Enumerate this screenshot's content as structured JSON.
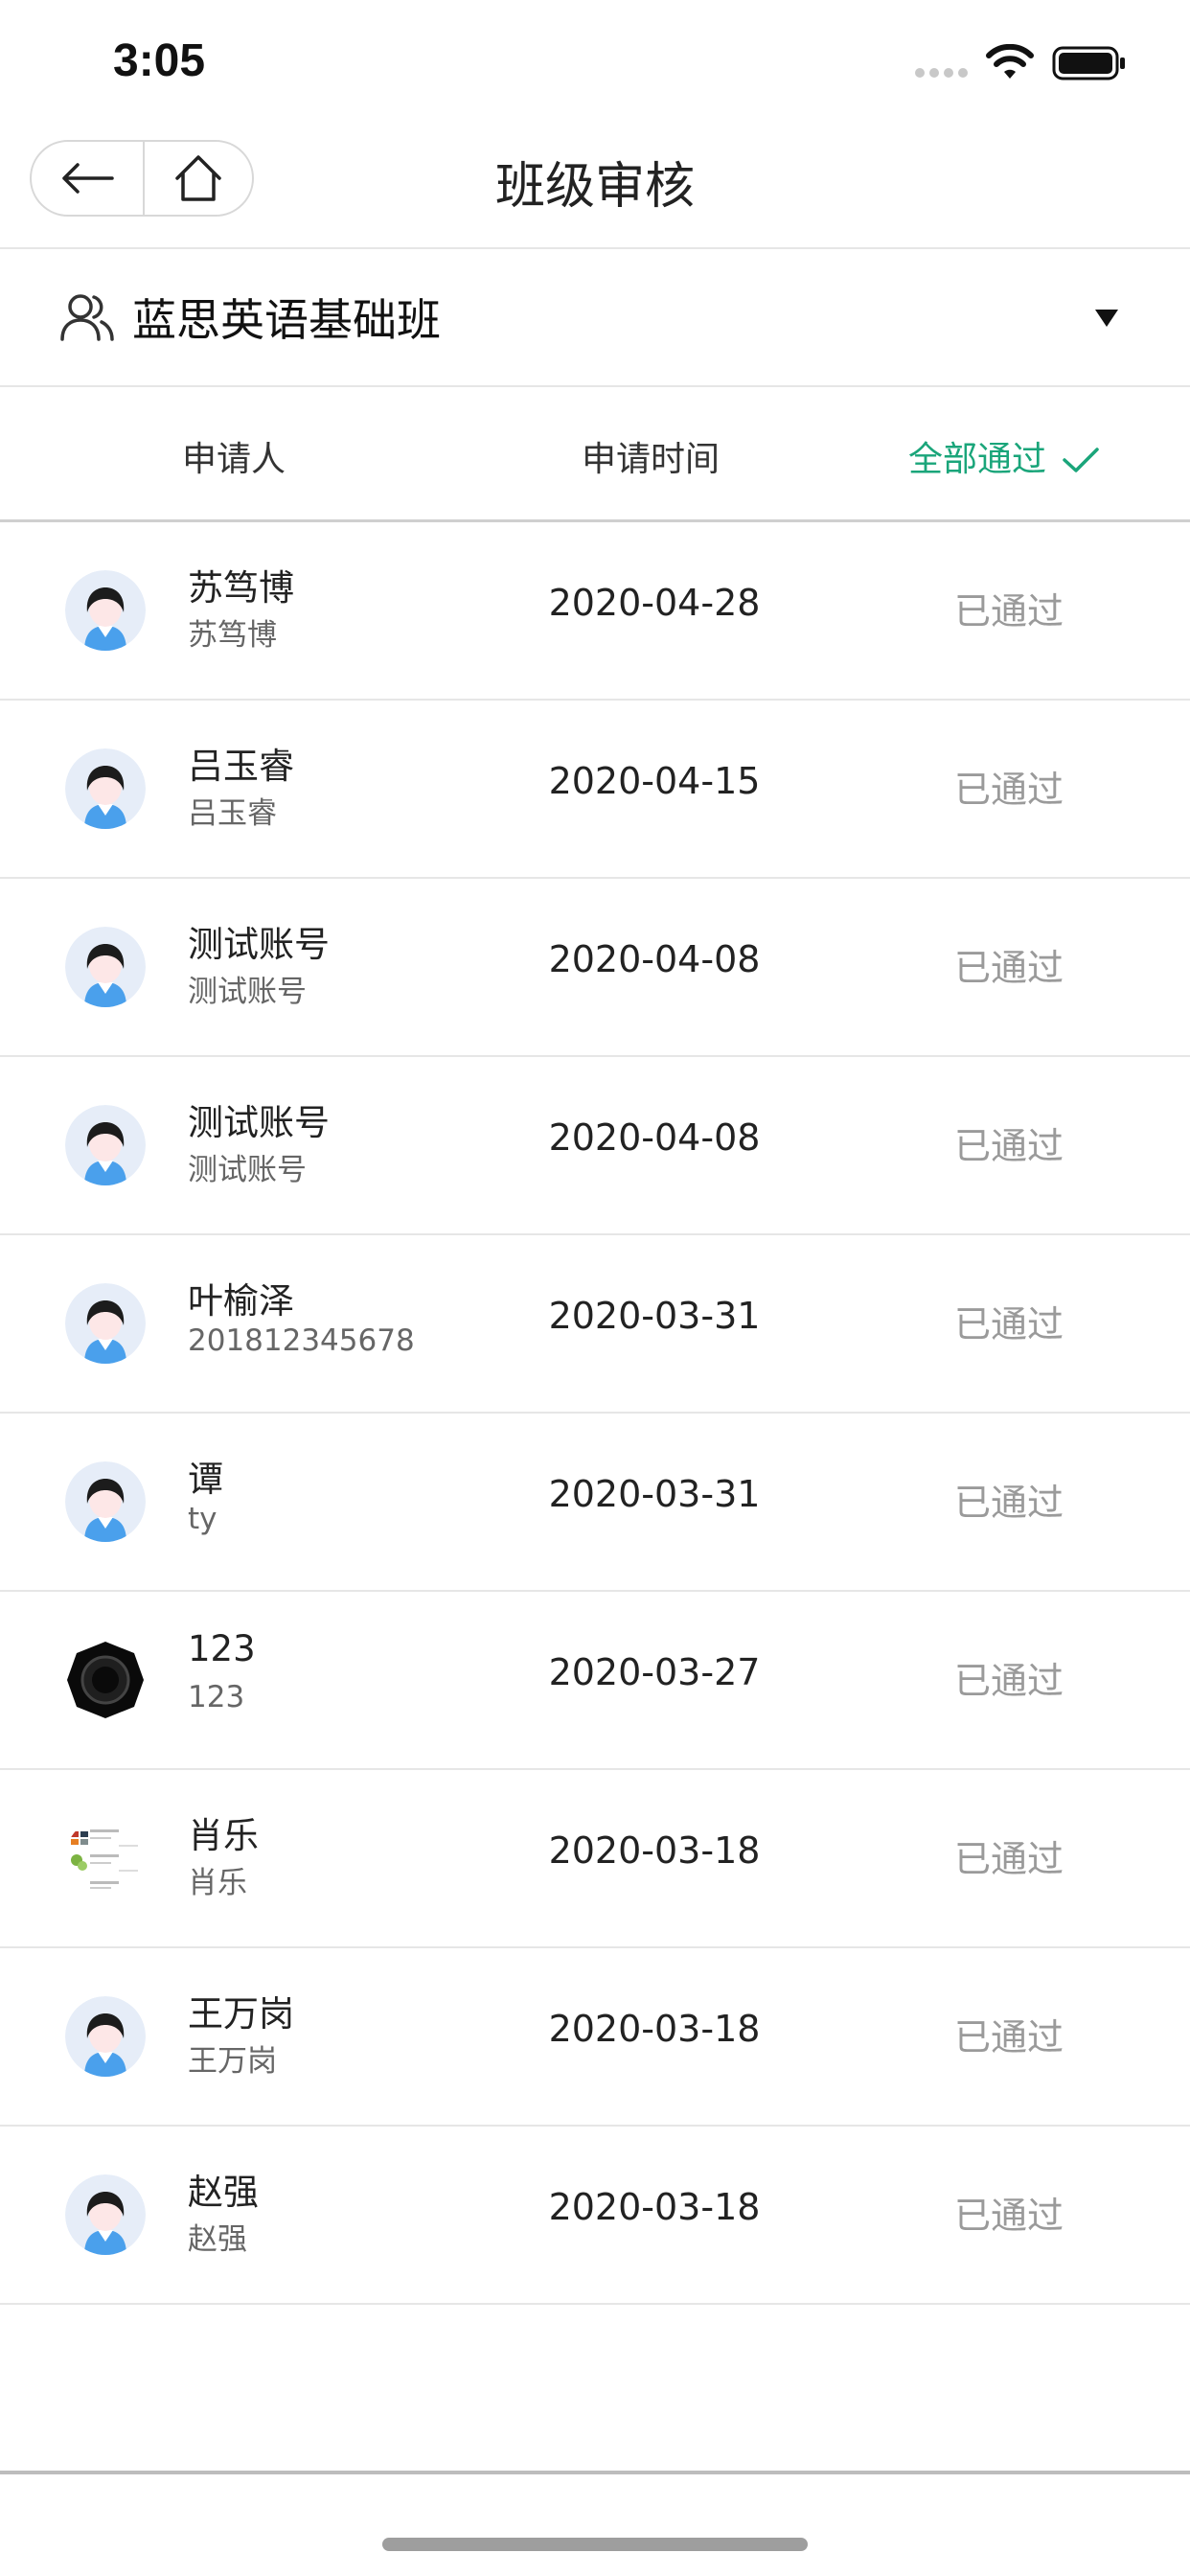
{
  "status_bar": {
    "time": "3:05"
  },
  "nav": {
    "title": "班级审核"
  },
  "class_selector": {
    "name": "蓝思英语基础班"
  },
  "table_header": {
    "applicant": "申请人",
    "time": "申请时间",
    "approve_all": "全部通过"
  },
  "colors": {
    "accent": "#1aa57a",
    "status_gray": "#9a9a9a"
  },
  "applicants": [
    {
      "name": "苏笃博",
      "sub": "苏笃博",
      "date": "2020-04-28",
      "status": "已通过",
      "avatar": "default-avatar-icon"
    },
    {
      "name": "吕玉睿",
      "sub": "吕玉睿",
      "date": "2020-04-15",
      "status": "已通过",
      "avatar": "default-avatar-icon"
    },
    {
      "name": "测试账号",
      "sub": "测试账号",
      "date": "2020-04-08",
      "status": "已通过",
      "avatar": "default-avatar-icon"
    },
    {
      "name": "测试账号",
      "sub": "测试账号",
      "date": "2020-04-08",
      "status": "已通过",
      "avatar": "default-avatar-icon"
    },
    {
      "name": "叶榆泽",
      "sub": "201812345678",
      "date": "2020-03-31",
      "status": "已通过",
      "avatar": "default-avatar-icon"
    },
    {
      "name": "谭",
      "sub": "ty",
      "date": "2020-03-31",
      "status": "已通过",
      "avatar": "default-avatar-icon"
    },
    {
      "name": "123",
      "sub": "123",
      "date": "2020-03-27",
      "status": "已通过",
      "avatar": "dark-ring-avatar-icon"
    },
    {
      "name": "肖乐",
      "sub": "肖乐",
      "date": "2020-03-18",
      "status": "已通过",
      "avatar": "screenshot-avatar-icon"
    },
    {
      "name": "王万岗",
      "sub": "王万岗",
      "date": "2020-03-18",
      "status": "已通过",
      "avatar": "default-avatar-icon"
    },
    {
      "name": "赵强",
      "sub": "赵强",
      "date": "2020-03-18",
      "status": "已通过",
      "avatar": "default-avatar-icon"
    }
  ]
}
